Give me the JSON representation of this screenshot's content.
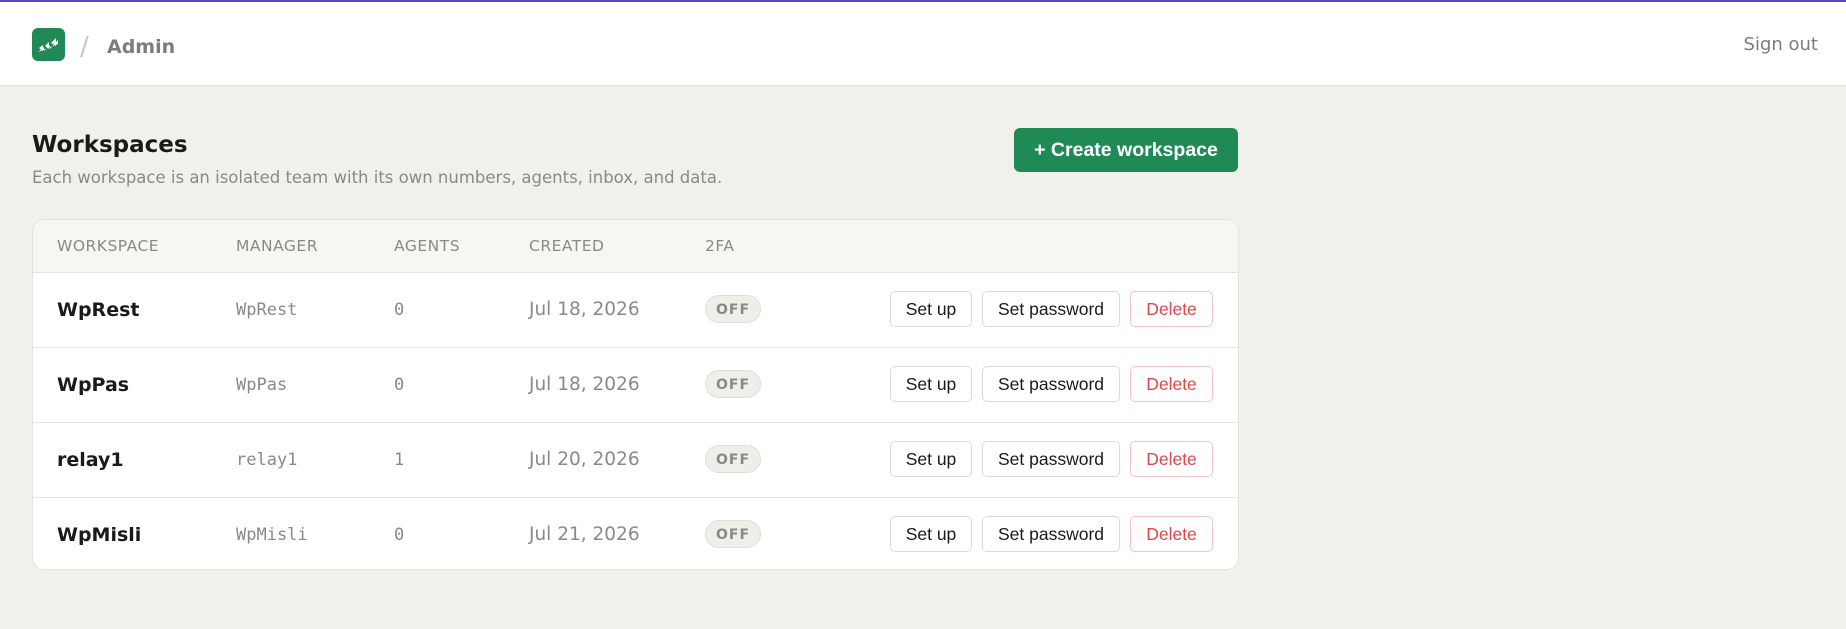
{
  "header": {
    "breadcrumb": "Admin",
    "signout_label": "Sign out"
  },
  "page": {
    "title": "Workspaces",
    "subtitle": "Each workspace is an isolated team with its own numbers, agents, inbox, and data.",
    "create_label": "+ Create workspace"
  },
  "table": {
    "columns": [
      "WORKSPACE",
      "MANAGER",
      "AGENTS",
      "CREATED",
      "2FA"
    ],
    "rows": [
      {
        "workspace": "WpRest",
        "manager": "WpRest",
        "agents": "0",
        "created": "Jul 18, 2026",
        "twofa": "OFF"
      },
      {
        "workspace": "WpPas",
        "manager": "WpPas",
        "agents": "0",
        "created": "Jul 18, 2026",
        "twofa": "OFF"
      },
      {
        "workspace": "relay1",
        "manager": "relay1",
        "agents": "1",
        "created": "Jul 20, 2026",
        "twofa": "OFF"
      },
      {
        "workspace": "WpMisli",
        "manager": "WpMisli",
        "agents": "0",
        "created": "Jul 21, 2026",
        "twofa": "OFF"
      }
    ],
    "actions": {
      "setup_label": "Set up",
      "password_label": "Set password",
      "delete_label": "Delete"
    }
  },
  "colors": {
    "accent": "#1f8a56",
    "top_border": "#5b3fd1",
    "danger": "#e0474c"
  },
  "icons": {
    "logo": "logo-icon"
  }
}
